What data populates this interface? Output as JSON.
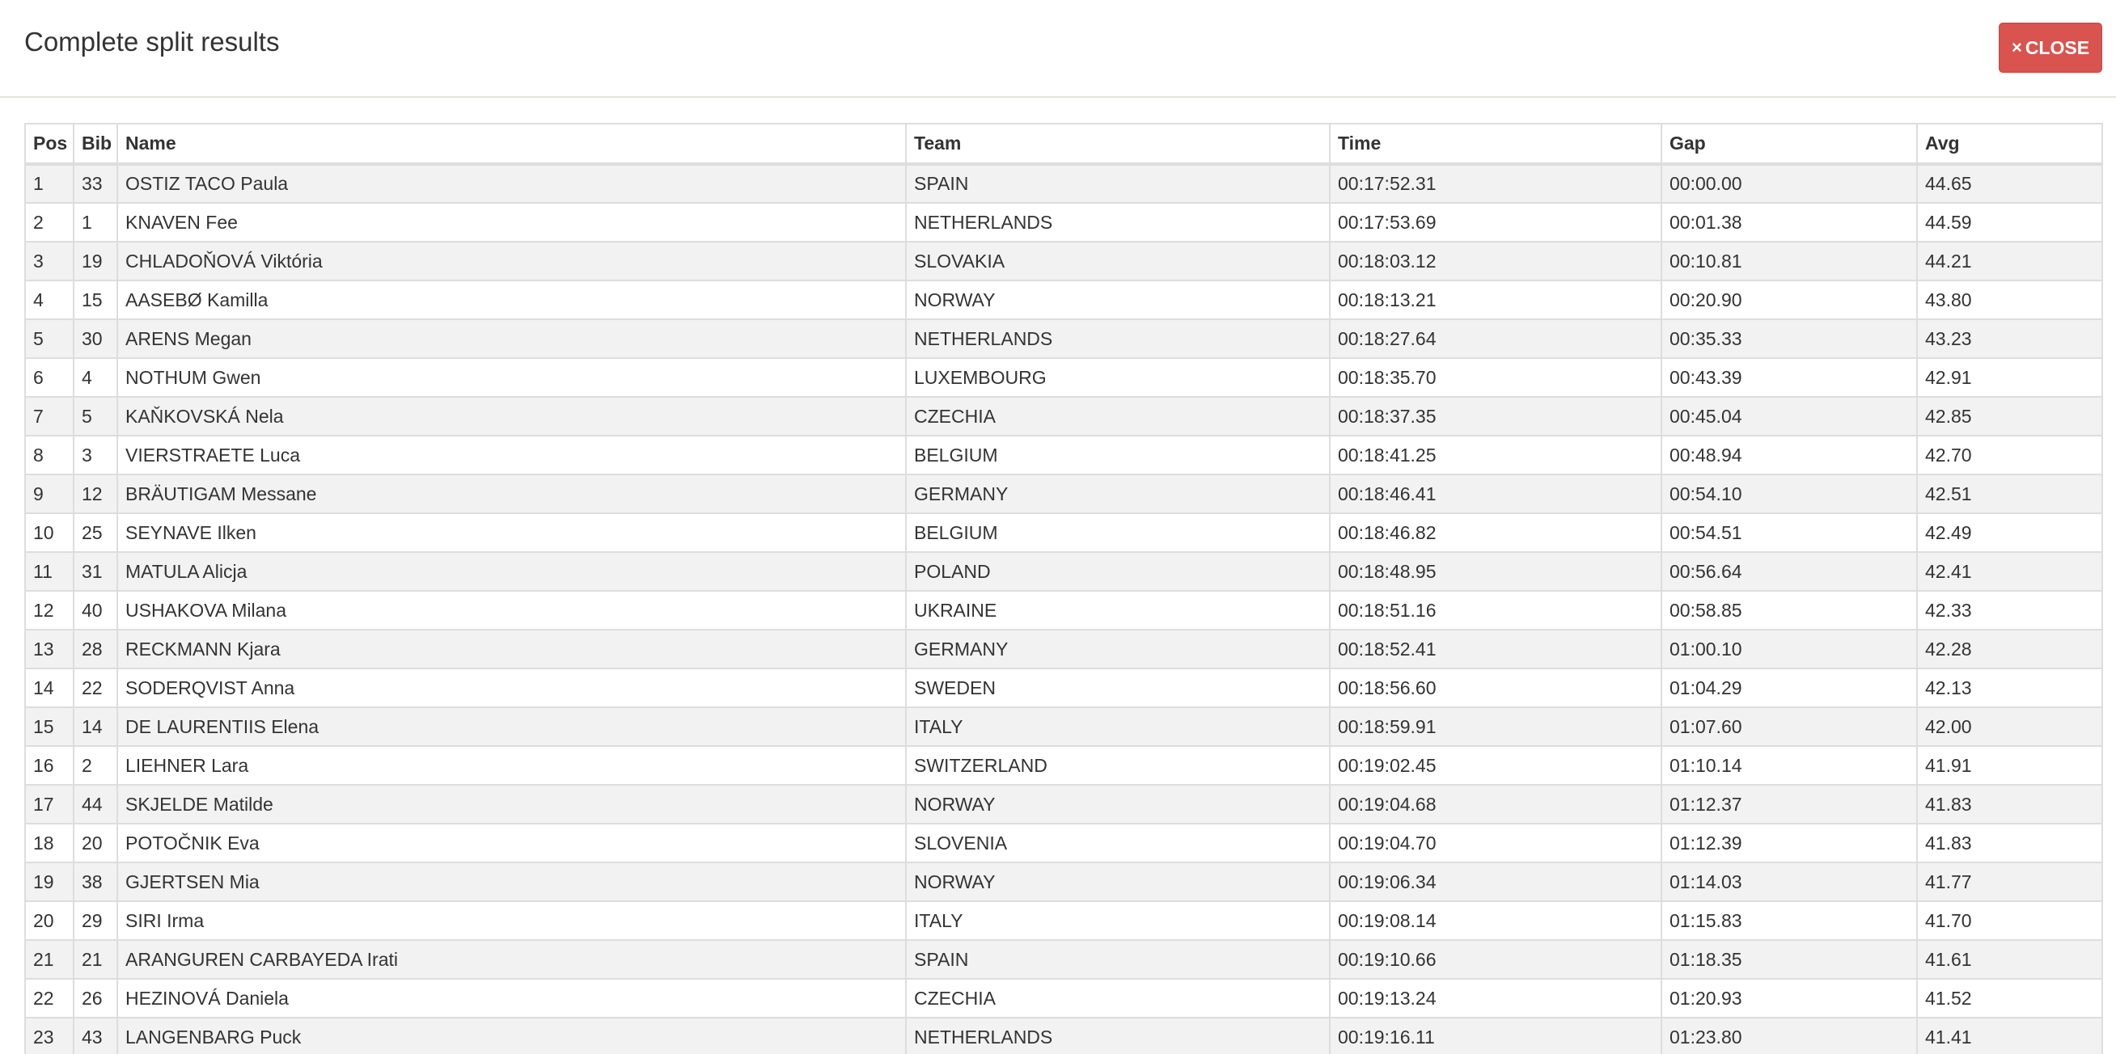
{
  "modal": {
    "title": "Complete split results",
    "close_icon": "×",
    "close_label": "CLOSE"
  },
  "table": {
    "headers": {
      "pos": "Pos",
      "bib": "Bib",
      "name": "Name",
      "team": "Team",
      "time": "Time",
      "gap": "Gap",
      "avg": "Avg"
    },
    "rows": [
      {
        "pos": "1",
        "bib": "33",
        "name": "OSTIZ TACO Paula",
        "team": "SPAIN",
        "time": "00:17:52.31",
        "gap": "00:00.00",
        "avg": "44.65"
      },
      {
        "pos": "2",
        "bib": "1",
        "name": "KNAVEN Fee",
        "team": "NETHERLANDS",
        "time": "00:17:53.69",
        "gap": "00:01.38",
        "avg": "44.59"
      },
      {
        "pos": "3",
        "bib": "19",
        "name": "CHLADOŇOVÁ Viktória",
        "team": "SLOVAKIA",
        "time": "00:18:03.12",
        "gap": "00:10.81",
        "avg": "44.21"
      },
      {
        "pos": "4",
        "bib": "15",
        "name": "AASEBØ Kamilla",
        "team": "NORWAY",
        "time": "00:18:13.21",
        "gap": "00:20.90",
        "avg": "43.80"
      },
      {
        "pos": "5",
        "bib": "30",
        "name": "ARENS Megan",
        "team": "NETHERLANDS",
        "time": "00:18:27.64",
        "gap": "00:35.33",
        "avg": "43.23"
      },
      {
        "pos": "6",
        "bib": "4",
        "name": "NOTHUM Gwen",
        "team": "LUXEMBOURG",
        "time": "00:18:35.70",
        "gap": "00:43.39",
        "avg": "42.91"
      },
      {
        "pos": "7",
        "bib": "5",
        "name": "KAŇKOVSKÁ Nela",
        "team": "CZECHIA",
        "time": "00:18:37.35",
        "gap": "00:45.04",
        "avg": "42.85"
      },
      {
        "pos": "8",
        "bib": "3",
        "name": "VIERSTRAETE Luca",
        "team": "BELGIUM",
        "time": "00:18:41.25",
        "gap": "00:48.94",
        "avg": "42.70"
      },
      {
        "pos": "9",
        "bib": "12",
        "name": "BRÄUTIGAM Messane",
        "team": "GERMANY",
        "time": "00:18:46.41",
        "gap": "00:54.10",
        "avg": "42.51"
      },
      {
        "pos": "10",
        "bib": "25",
        "name": "SEYNAVE Ilken",
        "team": "BELGIUM",
        "time": "00:18:46.82",
        "gap": "00:54.51",
        "avg": "42.49"
      },
      {
        "pos": "11",
        "bib": "31",
        "name": "MATULA Alicja",
        "team": "POLAND",
        "time": "00:18:48.95",
        "gap": "00:56.64",
        "avg": "42.41"
      },
      {
        "pos": "12",
        "bib": "40",
        "name": "USHAKOVA Milana",
        "team": "UKRAINE",
        "time": "00:18:51.16",
        "gap": "00:58.85",
        "avg": "42.33"
      },
      {
        "pos": "13",
        "bib": "28",
        "name": "RECKMANN Kjara",
        "team": "GERMANY",
        "time": "00:18:52.41",
        "gap": "01:00.10",
        "avg": "42.28"
      },
      {
        "pos": "14",
        "bib": "22",
        "name": "SODERQVIST Anna",
        "team": "SWEDEN",
        "time": "00:18:56.60",
        "gap": "01:04.29",
        "avg": "42.13"
      },
      {
        "pos": "15",
        "bib": "14",
        "name": "DE LAURENTIIS Elena",
        "team": "ITALY",
        "time": "00:18:59.91",
        "gap": "01:07.60",
        "avg": "42.00"
      },
      {
        "pos": "16",
        "bib": "2",
        "name": "LIEHNER Lara",
        "team": "SWITZERLAND",
        "time": "00:19:02.45",
        "gap": "01:10.14",
        "avg": "41.91"
      },
      {
        "pos": "17",
        "bib": "44",
        "name": "SKJELDE Matilde",
        "team": "NORWAY",
        "time": "00:19:04.68",
        "gap": "01:12.37",
        "avg": "41.83"
      },
      {
        "pos": "18",
        "bib": "20",
        "name": "POTOČNIK Eva",
        "team": "SLOVENIA",
        "time": "00:19:04.70",
        "gap": "01:12.39",
        "avg": "41.83"
      },
      {
        "pos": "19",
        "bib": "38",
        "name": "GJERTSEN Mia",
        "team": "NORWAY",
        "time": "00:19:06.34",
        "gap": "01:14.03",
        "avg": "41.77"
      },
      {
        "pos": "20",
        "bib": "29",
        "name": "SIRI Irma",
        "team": "ITALY",
        "time": "00:19:08.14",
        "gap": "01:15.83",
        "avg": "41.70"
      },
      {
        "pos": "21",
        "bib": "21",
        "name": "ARANGUREN CARBAYEDA Irati",
        "team": "SPAIN",
        "time": "00:19:10.66",
        "gap": "01:18.35",
        "avg": "41.61"
      },
      {
        "pos": "22",
        "bib": "26",
        "name": "HEZINOVÁ Daniela",
        "team": "CZECHIA",
        "time": "00:19:13.24",
        "gap": "01:20.93",
        "avg": "41.52"
      },
      {
        "pos": "23",
        "bib": "43",
        "name": "LANGENBARG Puck",
        "team": "NETHERLANDS",
        "time": "00:19:16.11",
        "gap": "01:23.80",
        "avg": "41.41"
      }
    ]
  }
}
